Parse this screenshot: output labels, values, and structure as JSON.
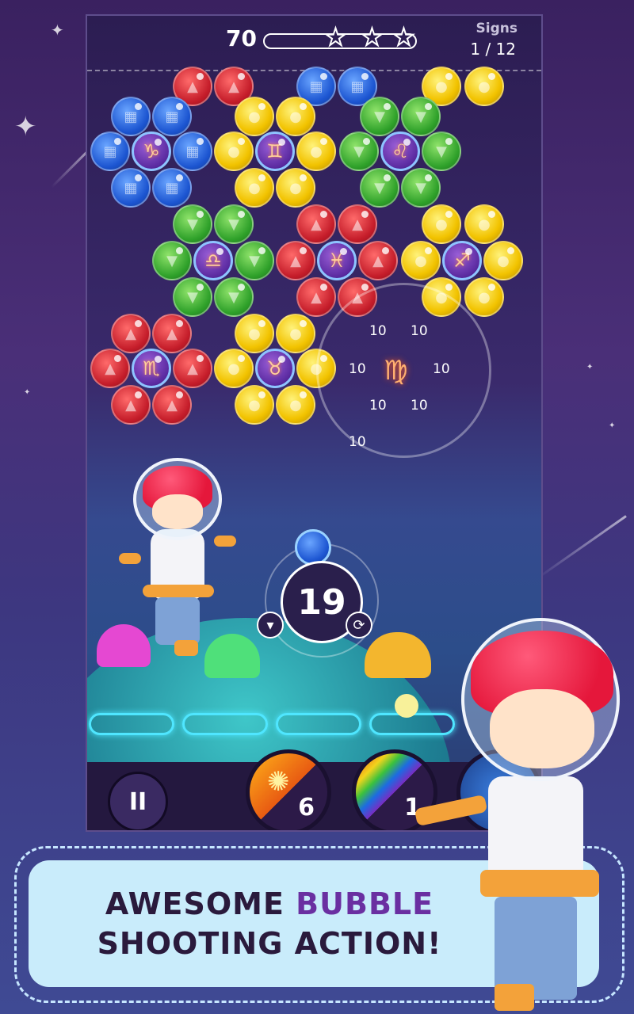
{
  "hud": {
    "score": "70",
    "stars_earned": 0,
    "stars_total": 3,
    "signs_label": "Signs",
    "signs_value": "1 / 12"
  },
  "popup": {
    "sign": "♍",
    "points": [
      "10",
      "10",
      "10",
      "10",
      "10",
      "10",
      "10"
    ]
  },
  "shooter": {
    "moves_left": "19",
    "next_bubble_color": "blue",
    "aim_icon": "down-arrow-icon",
    "swap_icon": "swap-icon"
  },
  "boosters": [
    {
      "name": "sun-burst-booster",
      "count": "6"
    },
    {
      "name": "rainbow-booster",
      "count": "1"
    }
  ],
  "controls": {
    "pause_icon": "pause-icon",
    "pause_glyph": "II"
  },
  "banner": {
    "line1_plain": "AWESOME ",
    "line1_highlight": "BUBBLE",
    "line2": "SHOOTING ACTION!"
  },
  "colors": {
    "red": "#c51d2a",
    "blue": "#1c55d1",
    "yellow": "#f2c300",
    "green": "#2fa12a",
    "zodiac_ring": "#8ec3ff",
    "banner_bg": "#c9ecfb",
    "banner_highlight": "#6a2fa1"
  },
  "board": {
    "bubbles": [
      {
        "color": "red"
      },
      {
        "color": "red"
      },
      {
        "color": "blue"
      },
      {
        "color": "blue"
      },
      {
        "color": "yellow"
      },
      {
        "color": "yellow"
      },
      {
        "color": "blue"
      },
      {
        "color": "blue"
      },
      {
        "color": "yellow"
      },
      {
        "color": "yellow"
      },
      {
        "color": "green"
      },
      {
        "color": "green"
      },
      {
        "color": "blue"
      },
      {
        "color": "zodiac",
        "sign": "♑"
      },
      {
        "color": "blue"
      },
      {
        "color": "yellow"
      },
      {
        "color": "zodiac",
        "sign": "♊"
      },
      {
        "color": "yellow"
      },
      {
        "color": "green"
      },
      {
        "color": "zodiac",
        "sign": "♌"
      },
      {
        "color": "green"
      },
      {
        "color": "blue"
      },
      {
        "color": "blue"
      },
      {
        "color": "yellow"
      },
      {
        "color": "yellow"
      },
      {
        "color": "green"
      },
      {
        "color": "green"
      },
      {
        "color": "green"
      },
      {
        "color": "green"
      },
      {
        "color": "red"
      },
      {
        "color": "red"
      },
      {
        "color": "yellow"
      },
      {
        "color": "yellow"
      },
      {
        "color": "green"
      },
      {
        "color": "zodiac",
        "sign": "♎"
      },
      {
        "color": "green"
      },
      {
        "color": "red"
      },
      {
        "color": "zodiac",
        "sign": "♓"
      },
      {
        "color": "red"
      },
      {
        "color": "yellow"
      },
      {
        "color": "zodiac",
        "sign": "♐"
      },
      {
        "color": "yellow"
      },
      {
        "color": "green"
      },
      {
        "color": "green"
      },
      {
        "color": "red"
      },
      {
        "color": "red"
      },
      {
        "color": "yellow"
      },
      {
        "color": "yellow"
      },
      {
        "color": "red"
      },
      {
        "color": "red"
      },
      {
        "color": "yellow"
      },
      {
        "color": "yellow"
      },
      {
        "color": "red"
      },
      {
        "color": "zodiac",
        "sign": "♏"
      },
      {
        "color": "red"
      },
      {
        "color": "yellow"
      },
      {
        "color": "zodiac",
        "sign": "♉"
      },
      {
        "color": "yellow"
      },
      {
        "color": "red"
      },
      {
        "color": "red"
      },
      {
        "color": "yellow"
      },
      {
        "color": "yellow"
      }
    ]
  }
}
